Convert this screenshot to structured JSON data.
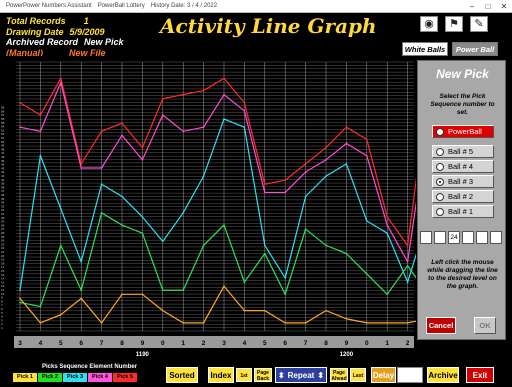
{
  "titlebar": {
    "items": [
      "PowerPower Numbers Assistant",
      "PowerBall Lottery",
      "History Date: 3 / 4 / 2022"
    ],
    "controls": [
      "–",
      "□",
      "✕"
    ]
  },
  "info": {
    "total_records_label": "Total Records",
    "total_records_value": "1",
    "drawing_date_label": "Drawing Date",
    "drawing_date_value": "5/9/2009",
    "archived_record_label": "Archived Record",
    "archived_record_value": "New Pick",
    "manual_label": "(Manual)",
    "new_file_label": "New File"
  },
  "page_title": "Activity Line Graph",
  "top_icons": [
    "camera-icon",
    "flag-icon",
    "document-icon"
  ],
  "ball_buttons": {
    "white_balls": "White Balls",
    "powerball": "Power Ball"
  },
  "colors": {
    "series": [
      "#ff2a2a",
      "#ff4dd2",
      "#2ee0ee",
      "#2ee05a",
      "#ffa726"
    ],
    "background": "#000000",
    "title": "#ffd93a"
  },
  "chart_data": {
    "type": "line",
    "title": "",
    "xlabel": "",
    "ylabel": "",
    "ylim": [
      0,
      59
    ],
    "grid": true,
    "categories": [
      "3",
      "4",
      "5",
      "6",
      "7",
      "8",
      "9",
      "0",
      "1",
      "2",
      "3",
      "4",
      "5",
      "6",
      "7",
      "8",
      "9",
      "0",
      "1",
      "2",
      "3"
    ],
    "group_labels": [
      {
        "label": "1190",
        "at_index": 6
      },
      {
        "label": "1200",
        "at_index": 16
      }
    ],
    "series": [
      {
        "values": [
          50,
          47,
          56,
          35,
          43,
          45,
          39,
          51,
          52,
          53,
          56,
          50,
          30,
          31,
          35,
          39,
          44,
          41,
          22,
          15,
          53
        ]
      },
      {
        "values": [
          44,
          43,
          55,
          34,
          34,
          42,
          36,
          47,
          43,
          44,
          52,
          48,
          28,
          28,
          33,
          36,
          40,
          37,
          20,
          11,
          45
        ]
      },
      {
        "values": [
          4,
          37,
          24,
          11,
          30,
          27,
          22,
          16,
          23,
          32,
          46,
          44,
          15,
          7,
          27,
          32,
          35,
          21,
          18,
          6,
          22
        ]
      },
      {
        "values": [
          1,
          0,
          15,
          4,
          23,
          20,
          18,
          4,
          4,
          15,
          20,
          6,
          13,
          3,
          19,
          15,
          13,
          8,
          3,
          10,
          3
        ]
      },
      {
        "values": [
          2,
          -4,
          -2,
          2,
          -4,
          3,
          3,
          -1,
          -4,
          -4,
          5,
          -1,
          -1,
          -4,
          -4,
          -1,
          -3,
          -4,
          -4,
          -4,
          -3
        ]
      }
    ],
    "new_pick_extension": {
      "values": [
        12
      ]
    },
    "y_tick_labels": [
      "1",
      "2",
      "3",
      "4",
      "5",
      "6",
      "7",
      "8",
      "9",
      "10",
      "11",
      "12",
      "13",
      "14",
      "15",
      "16",
      "17",
      "18",
      "19",
      "20",
      "21",
      "22",
      "23",
      "24",
      "25",
      "26",
      "27",
      "28",
      "29",
      "30",
      "31",
      "32",
      "33",
      "34",
      "35",
      "36",
      "37",
      "38",
      "39",
      "40",
      "41",
      "42",
      "43",
      "44",
      "45",
      "46",
      "47",
      "48",
      "49",
      "50",
      "51",
      "52",
      "53",
      "54",
      "55",
      "56",
      "57",
      "58",
      "59"
    ]
  },
  "panel": {
    "title": "New Pick",
    "instruction": "Select the Pick Sequence number to set.",
    "options": [
      {
        "label": "PowerBall",
        "checked": false,
        "red": true
      },
      {
        "label": "Ball # 5",
        "checked": false
      },
      {
        "label": "Ball # 4",
        "checked": false
      },
      {
        "label": "Ball # 3",
        "checked": true
      },
      {
        "label": "Ball # 2",
        "checked": false
      },
      {
        "label": "Ball # 1",
        "checked": false
      }
    ],
    "digits": [
      "",
      "",
      "24",
      "",
      "",
      ""
    ],
    "hint": "Left click the mouse while dragging the line to the desired level on the graph.",
    "cancel": "Cancel",
    "ok": "OK"
  },
  "bottom": {
    "legend_title": "Picks Sequence Element Number",
    "legend": [
      {
        "label": "Pick 1",
        "color": "#ffe23a"
      },
      {
        "label": "Pick 2",
        "color": "#22e022"
      },
      {
        "label": "Pick 3",
        "color": "#2ee0ee"
      },
      {
        "label": "Pick 4",
        "color": "#ff55dd"
      },
      {
        "label": "Pick 5",
        "color": "#ff2a2a"
      }
    ],
    "sorted": "Sorted",
    "index": "Index",
    "first": "1st",
    "page_back": "Page Back",
    "repeat": "Repeat",
    "page_ahead": "Page Ahead",
    "last": "Last",
    "delay": "Delay",
    "archive": "Archive",
    "exit": "Exit"
  }
}
